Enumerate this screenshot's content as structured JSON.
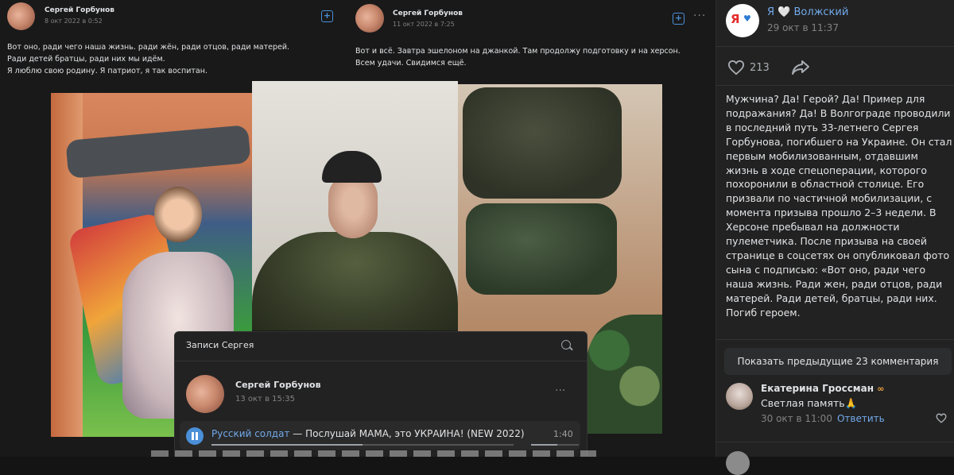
{
  "collage": {
    "post1": {
      "author": "Сергей Горбунов",
      "date": "8 окт 2022 в 0:52",
      "lines": [
        "Вот оно, ради чего наша жизнь. ради жён, ради отцов, ради матерей.",
        "Ради детей братцы, ради них мы идём.",
        "Я люблю свою родину. Я патриот, я так воспитан."
      ]
    },
    "post2": {
      "author": "Сергей Горбунов",
      "date": "11 окт 2022 в 7:25",
      "lines": [
        "Вот и всё. Завтра эшелоном на джанкой. Там продолжу подготовку и на херсон.",
        "Всем удачи. Свидимся ещё."
      ]
    },
    "records": {
      "title": "Записи Сергея",
      "author": "Сергей Горбунов",
      "date": "13 окт в 15:35",
      "audio": {
        "artist": "Русский солдат",
        "separator": " — ",
        "song": "Послушай МАМА, это УКРАИНА! (NEW 2022)",
        "duration": "1:40",
        "progress": 0.5,
        "volume": 0.55
      }
    },
    "icons": {
      "add": "plus-square-icon",
      "more": "more-dots-icon",
      "search": "search-icon",
      "play": "pause-icon"
    }
  },
  "sidebar": {
    "group_logo_text_1": "Я",
    "group_logo_text_2": "♥",
    "group_name": "Я",
    "group_heart": "🤍",
    "group_city": "Волжский",
    "post_date": "29 окт в 11:37",
    "likes": "213",
    "body": "Мужчина? Да! Герой? Да! Пример для подражания? Да! В Волгограде проводили в последний путь 33-летнего Сергея Горбунова, погибшего на Украине. Он стал первым мобилизованным, отдавшим жизнь в ходе спецоперации, которого похоронили в областной столице. Его призвали по частичной мобилизации, с момента призыва прошло 2–3 недели. В Херсоне пребывал на должности пулеметчика. После призыва на своей странице в соцсетях он опубликовал фото сына с подписью: «Вот оно, ради чего наша жизнь. Ради жен, ради отцов, ради матерей. Ради детей, братцы, ради них. Погиб героем.",
    "show_prev_comments": "Показать предыдущие 23 комментария",
    "comment": {
      "author": "Екатерина Гроссман",
      "badge": "∞",
      "text": "Светлая память🙏",
      "date": "30 окт в 11:00",
      "reply": "Ответить"
    },
    "accent": "#71aaeb",
    "background": "#222222"
  }
}
